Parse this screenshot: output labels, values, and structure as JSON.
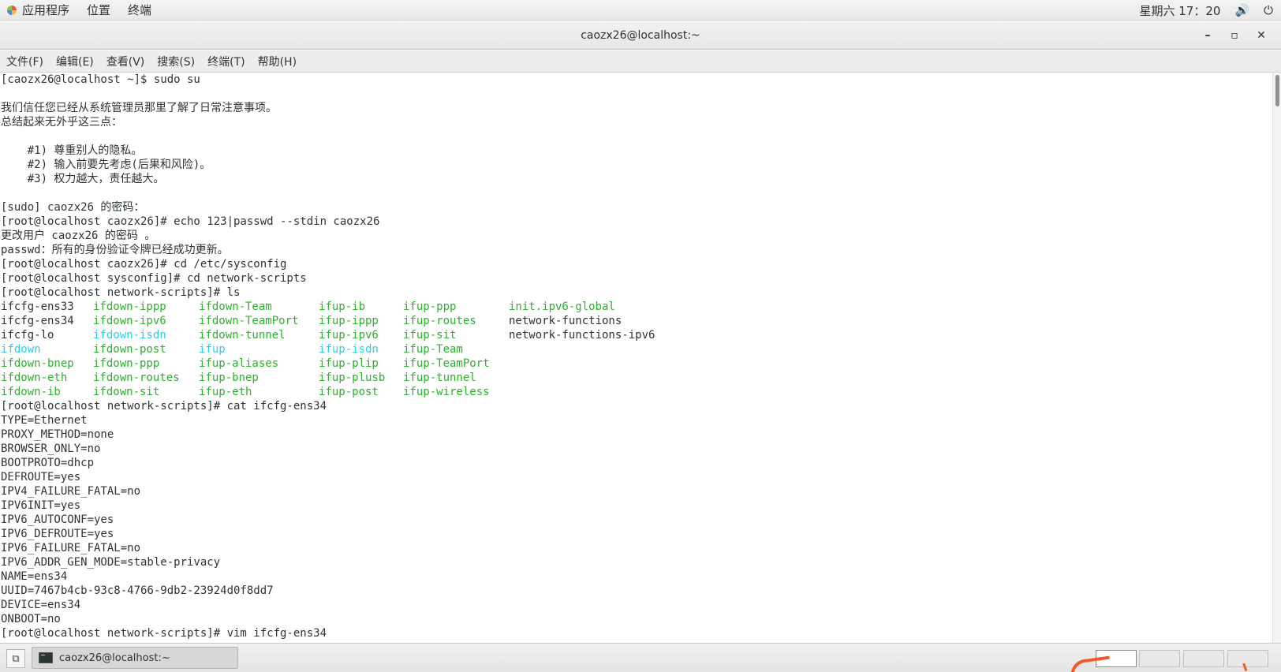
{
  "topbar": {
    "applications": "应用程序",
    "places": "位置",
    "terminal": "终端",
    "clock": "星期六 17：20",
    "volume_icon": "speaker-icon",
    "power_icon": "power-icon"
  },
  "window": {
    "title": "caozx26@localhost:~",
    "minimize": "–",
    "maximize": "▫",
    "close": "✕"
  },
  "menubar": {
    "file": "文件(F)",
    "edit": "编辑(E)",
    "view": "查看(V)",
    "search": "搜索(S)",
    "terminal": "终端(T)",
    "help": "帮助(H)"
  },
  "terminal": {
    "lines_top": [
      "[caozx26@localhost ~]$ sudo su",
      "",
      "我们信任您已经从系统管理员那里了解了日常注意事项。",
      "总结起来无外乎这三点：",
      "",
      "    #1) 尊重别人的隐私。",
      "    #2) 输入前要先考虑(后果和风险)。",
      "    #3) 权力越大，责任越大。",
      "",
      "[sudo] caozx26 的密码：",
      "[root@localhost caozx26]# echo 123|passwd --stdin caozx26",
      "更改用户 caozx26 的密码 。",
      "passwd：所有的身份验证令牌已经成功更新。",
      "[root@localhost caozx26]# cd /etc/sysconfig",
      "[root@localhost sysconfig]# cd network-scripts",
      "[root@localhost network-scripts]# ls"
    ],
    "ls_rows": [
      [
        {
          "t": "ifcfg-ens33",
          "c": "plain"
        },
        {
          "t": "ifdown-ippp",
          "c": "green"
        },
        {
          "t": "ifdown-Team",
          "c": "green"
        },
        {
          "t": "ifup-ib",
          "c": "green"
        },
        {
          "t": "ifup-ppp",
          "c": "green"
        },
        {
          "t": "init.ipv6-global",
          "c": "green"
        }
      ],
      [
        {
          "t": "ifcfg-ens34",
          "c": "plain"
        },
        {
          "t": "ifdown-ipv6",
          "c": "green"
        },
        {
          "t": "ifdown-TeamPort",
          "c": "green"
        },
        {
          "t": "ifup-ippp",
          "c": "green"
        },
        {
          "t": "ifup-routes",
          "c": "green"
        },
        {
          "t": "network-functions",
          "c": "plain"
        }
      ],
      [
        {
          "t": "ifcfg-lo",
          "c": "plain"
        },
        {
          "t": "ifdown-isdn",
          "c": "cyan"
        },
        {
          "t": "ifdown-tunnel",
          "c": "green"
        },
        {
          "t": "ifup-ipv6",
          "c": "green"
        },
        {
          "t": "ifup-sit",
          "c": "green"
        },
        {
          "t": "network-functions-ipv6",
          "c": "plain"
        }
      ],
      [
        {
          "t": "ifdown",
          "c": "cyan"
        },
        {
          "t": "ifdown-post",
          "c": "green"
        },
        {
          "t": "ifup",
          "c": "cyan"
        },
        {
          "t": "ifup-isdn",
          "c": "cyan"
        },
        {
          "t": "ifup-Team",
          "c": "green"
        },
        {
          "t": "",
          "c": "plain"
        }
      ],
      [
        {
          "t": "ifdown-bnep",
          "c": "green"
        },
        {
          "t": "ifdown-ppp",
          "c": "green"
        },
        {
          "t": "ifup-aliases",
          "c": "green"
        },
        {
          "t": "ifup-plip",
          "c": "green"
        },
        {
          "t": "ifup-TeamPort",
          "c": "green"
        },
        {
          "t": "",
          "c": "plain"
        }
      ],
      [
        {
          "t": "ifdown-eth",
          "c": "green"
        },
        {
          "t": "ifdown-routes",
          "c": "green"
        },
        {
          "t": "ifup-bnep",
          "c": "green"
        },
        {
          "t": "ifup-plusb",
          "c": "green"
        },
        {
          "t": "ifup-tunnel",
          "c": "green"
        },
        {
          "t": "",
          "c": "plain"
        }
      ],
      [
        {
          "t": "ifdown-ib",
          "c": "green"
        },
        {
          "t": "ifdown-sit",
          "c": "green"
        },
        {
          "t": "ifup-eth",
          "c": "green"
        },
        {
          "t": "ifup-post",
          "c": "green"
        },
        {
          "t": "ifup-wireless",
          "c": "green"
        },
        {
          "t": "",
          "c": "plain"
        }
      ]
    ],
    "lines_bottom": [
      "[root@localhost network-scripts]# cat ifcfg-ens34",
      "TYPE=Ethernet",
      "PROXY_METHOD=none",
      "BROWSER_ONLY=no",
      "BOOTPROTO=dhcp",
      "DEFROUTE=yes",
      "IPV4_FAILURE_FATAL=no",
      "IPV6INIT=yes",
      "IPV6_AUTOCONF=yes",
      "IPV6_DEFROUTE=yes",
      "IPV6_FAILURE_FATAL=no",
      "IPV6_ADDR_GEN_MODE=stable-privacy",
      "NAME=ens34",
      "UUID=7467b4cb-93c8-4766-9db2-23924d0f8dd7",
      "DEVICE=ens34",
      "ONBOOT=no",
      "[root@localhost network-scripts]# vim ifcfg-ens34"
    ],
    "colors": {
      "green": "#2eb12e",
      "cyan": "#27d0ef",
      "plain": "#2e3436"
    }
  },
  "taskbar": {
    "task_label": "caozx26@localhost:~",
    "show_desktop_icon": "show-desktop-icon",
    "terminal_icon": "terminal-icon",
    "workspaces": 4
  }
}
